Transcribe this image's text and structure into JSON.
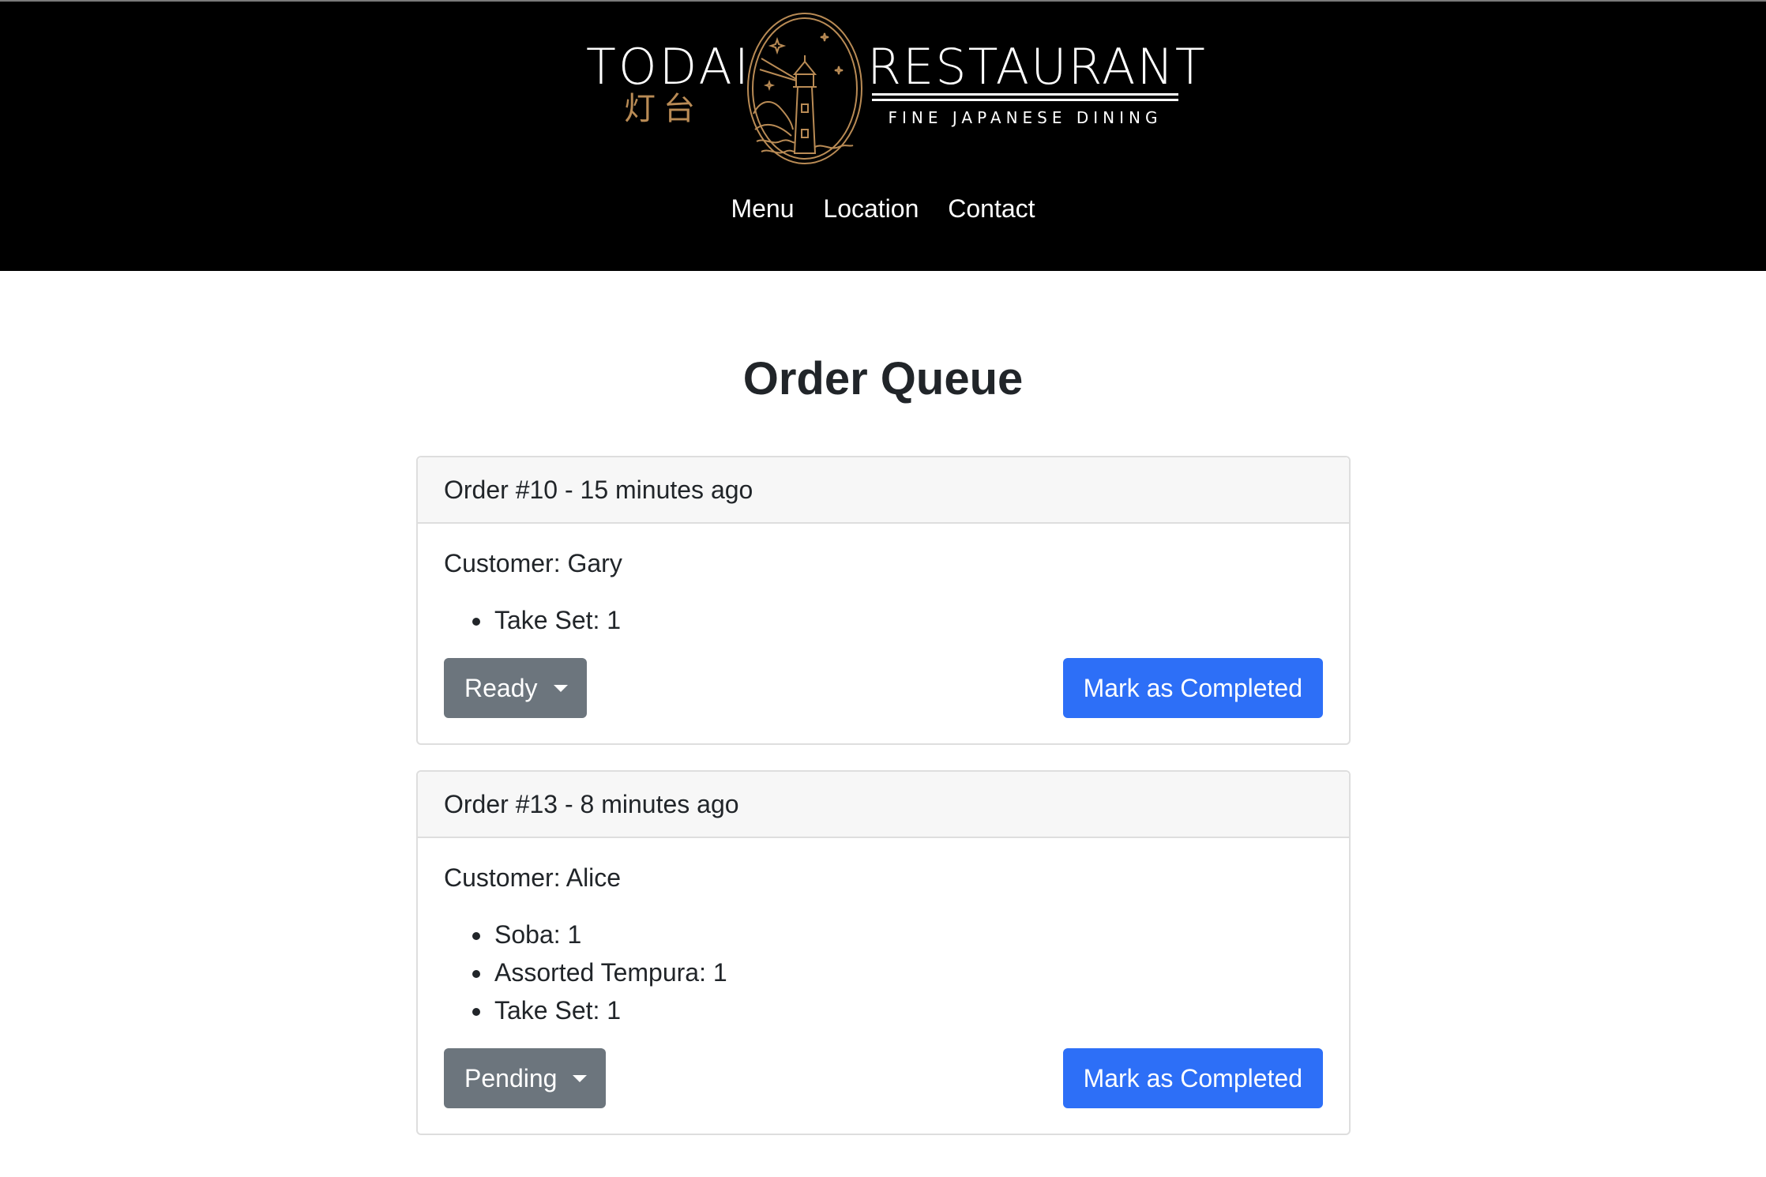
{
  "brand": {
    "left_word": "TODAI",
    "kanji": "灯台",
    "right_word": "RESTAURANT",
    "tagline": "FINE JAPANESE DINING",
    "accent_color": "#b98b55"
  },
  "nav": {
    "items": [
      "Menu",
      "Location",
      "Contact"
    ]
  },
  "page": {
    "title": "Order Queue"
  },
  "orders": [
    {
      "header": "Order #10 - 15 minutes ago",
      "customer": "Customer: Gary",
      "items": [
        "Take Set: 1"
      ],
      "status": "Ready",
      "complete_label": "Mark as Completed"
    },
    {
      "header": "Order #13 - 8 minutes ago",
      "customer": "Customer: Alice",
      "items": [
        "Soba: 1",
        "Assorted Tempura: 1",
        "Take Set: 1"
      ],
      "status": "Pending",
      "complete_label": "Mark as Completed"
    }
  ],
  "colors": {
    "header_bg": "#000000",
    "primary": "#2d6ff7",
    "secondary": "#6c757d"
  }
}
